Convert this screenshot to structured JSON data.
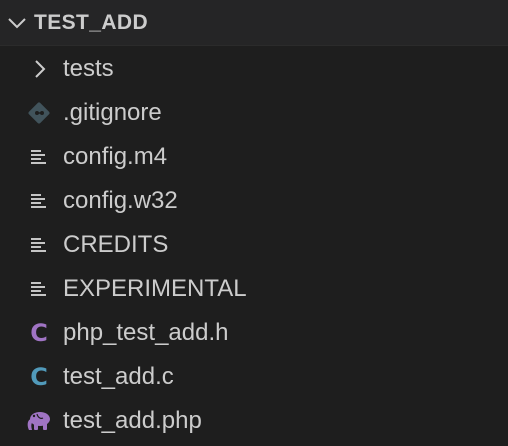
{
  "explorer": {
    "section_title": "TEST_ADD",
    "items": [
      {
        "label": "tests",
        "icon": "chevron-right-icon"
      },
      {
        "label": ".gitignore",
        "icon": "git-icon"
      },
      {
        "label": "config.m4",
        "icon": "text-file-icon"
      },
      {
        "label": "config.w32",
        "icon": "text-file-icon"
      },
      {
        "label": "CREDITS",
        "icon": "text-file-icon"
      },
      {
        "label": "EXPERIMENTAL",
        "icon": "text-file-icon"
      },
      {
        "label": "php_test_add.h",
        "icon": "c-header-icon",
        "icon_text": "C",
        "icon_color": "#a074c4"
      },
      {
        "label": "test_add.c",
        "icon": "c-source-icon",
        "icon_text": "C",
        "icon_color": "#519aba"
      },
      {
        "label": "test_add.php",
        "icon": "php-elephant-icon",
        "icon_color": "#a074c4"
      }
    ]
  },
  "colors": {
    "background": "#1e1e1e",
    "header_background": "#252526",
    "text": "#cccccc",
    "git_icon": "#41535b",
    "c_header": "#a074c4",
    "c_source": "#519aba",
    "php": "#a074c4"
  }
}
